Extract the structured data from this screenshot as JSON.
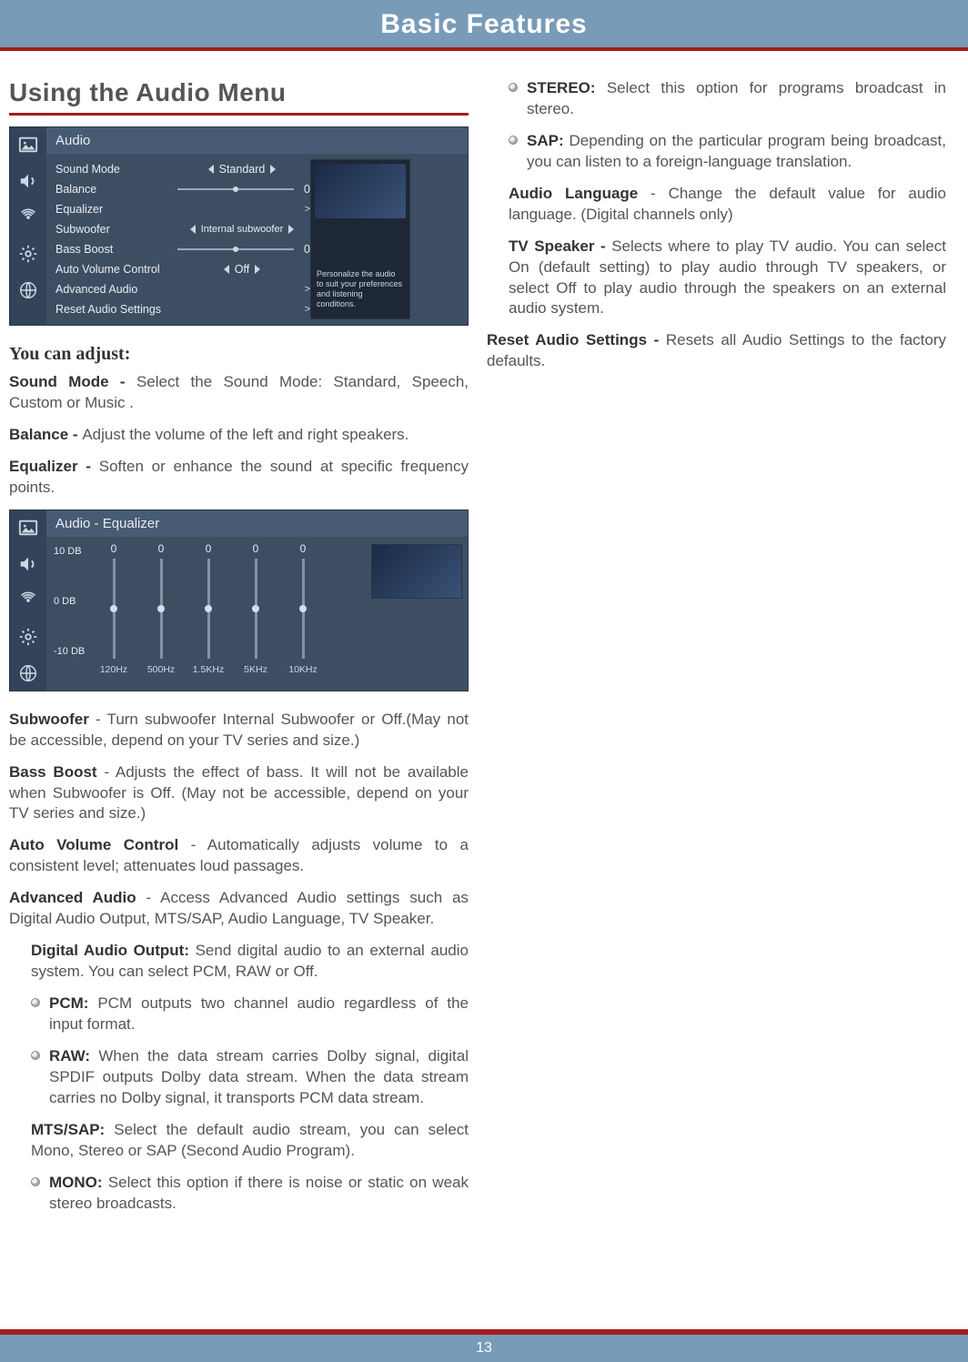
{
  "header": {
    "title": "Basic Features"
  },
  "section": {
    "title": "Using the Audio Menu"
  },
  "osd_audio": {
    "title": "Audio",
    "rows": {
      "sound_mode": "Sound Mode",
      "balance": "Balance",
      "equalizer": "Equalizer",
      "subwoofer": "Subwoofer",
      "bass_boost": "Bass Boost",
      "auto_volume": "Auto Volume Control",
      "advanced": "Advanced Audio",
      "reset": "Reset Audio Settings"
    },
    "values": {
      "sound_mode": "Standard",
      "balance": "0",
      "equalizer": ">",
      "subwoofer": "Internal subwoofer",
      "bass_boost": "0",
      "auto_volume": "Off",
      "advanced": ">",
      "reset": ">"
    },
    "hint": "Personalize the audio to suit your preferences and listening conditions."
  },
  "osd_eq": {
    "title": "Audio - Equalizer",
    "y": {
      "top": "10 DB",
      "mid": "0 DB",
      "bot": "-10 DB"
    },
    "bars": [
      {
        "val": "0",
        "freq": "120Hz"
      },
      {
        "val": "0",
        "freq": "500Hz"
      },
      {
        "val": "0",
        "freq": "1.5KHz"
      },
      {
        "val": "0",
        "freq": "5KHz"
      },
      {
        "val": "0",
        "freq": "10KHz"
      }
    ]
  },
  "text": {
    "you_can_adjust": "You can adjust:",
    "sound_mode_b": "Sound Mode - ",
    "sound_mode": "Select the Sound Mode: Standard, Speech, Custom or Music .",
    "balance_b": "Balance - ",
    "balance": "Adjust the volume of the left and right speakers.",
    "equalizer_b": "Equalizer - ",
    "equalizer": "Soften or enhance the sound at specific frequency points.",
    "subwoofer_b": "Subwoofer",
    "subwoofer": " - Turn subwoofer Internal Subwoofer or Off.(May not be accessible, depend on your TV series and size.)",
    "bass_b": "Bass Boost",
    "bass": " - Adjusts the effect of bass. It will not be available when Subwoofer is Off. (May not be accessible, depend on your TV series and size.)",
    "avc_b": "Auto Volume Control",
    "avc": " - Automatically adjusts volume to a consistent level; attenuates loud passages.",
    "adv_b": "Advanced Audio",
    "adv": " - Access Advanced Audio settings such as Digital Audio Output, MTS/SAP, Audio Language, TV Speaker.",
    "dao_b": "Digital Audio Output: ",
    "dao": "Send digital audio to an external audio system. You can select PCM, RAW or Off.",
    "pcm_b": "PCM: ",
    "pcm": "PCM outputs two channel audio regardless of the input format.",
    "raw_b": "RAW: ",
    "raw": "When the data stream carries Dolby signal, digital SPDIF outputs Dolby data stream. When the data stream carries no Dolby signal, it transports PCM data stream.",
    "mts_b": "MTS/SAP: ",
    "mts": "Select the default audio stream, you can select Mono, Stereo or SAP (Second Audio Program).",
    "mono_b": "MONO: ",
    "mono": "Select this option if there is noise or static on weak stereo broadcasts.",
    "stereo_b": "STEREO: ",
    "stereo": "Select this option for programs broadcast in stereo.",
    "sap_b": "SAP: ",
    "sap": "Depending on the particular program being broadcast, you can listen to a foreign-language translation.",
    "alang_b": "Audio Language",
    "alang": " - Change the default value for audio language. (Digital channels only)",
    "tvspk_b": "TV Speaker - ",
    "tvspk": "Selects where to play TV audio. You can select On (default setting) to play audio through TV speakers, or select Off to play audio through the speakers on an external audio system.",
    "reset_b": "Reset Audio Settings - ",
    "reset": "Resets all Audio Settings to the factory defaults."
  },
  "footer": {
    "page": "13"
  }
}
